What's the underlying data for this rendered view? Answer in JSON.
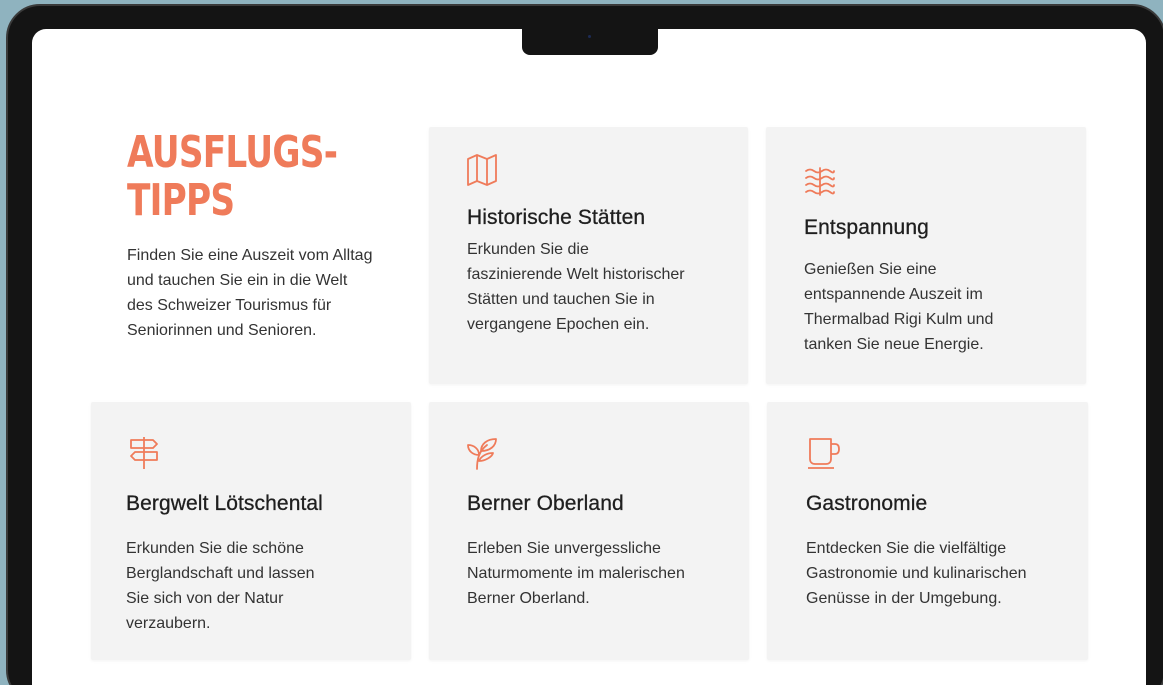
{
  "colors": {
    "accent": "#ef7b5a",
    "card_bg": "#f3f3f3",
    "background": "#8fb3bf"
  },
  "intro": {
    "title": "AUSFLUGS-\nTIPPS",
    "text": "Finden Sie eine Auszeit vom Alltag und tauchen Sie ein in die Welt des Schweizer Tourismus für Seniorinnen und Senioren."
  },
  "cards": [
    {
      "icon": "map-icon",
      "title": "Historische Stätten",
      "text": "Erkunden Sie die faszinierende Welt historischer Stätten und tauchen Sie in vergangene Epochen ein."
    },
    {
      "icon": "waves-icon",
      "title": "Entspannung",
      "text": "Genießen Sie eine entspannende Auszeit im Thermalbad Rigi Kulm und tanken Sie neue Energie."
    },
    {
      "icon": "signpost-icon",
      "title": "Bergwelt Lötschental",
      "text": "Erkunden Sie die schöne Berglandschaft und lassen Sie sich von der Natur verzaubern."
    },
    {
      "icon": "sprout-icon",
      "title": "Berner Oberland",
      "text": "Erleben Sie unvergessliche Naturmomente im malerischen Berner Oberland."
    },
    {
      "icon": "coffee-cup-icon",
      "title": "Gastronomie",
      "text": "Entdecken Sie die vielfältige Gastronomie und kulinarischen Genüsse in der Umgebung."
    }
  ]
}
